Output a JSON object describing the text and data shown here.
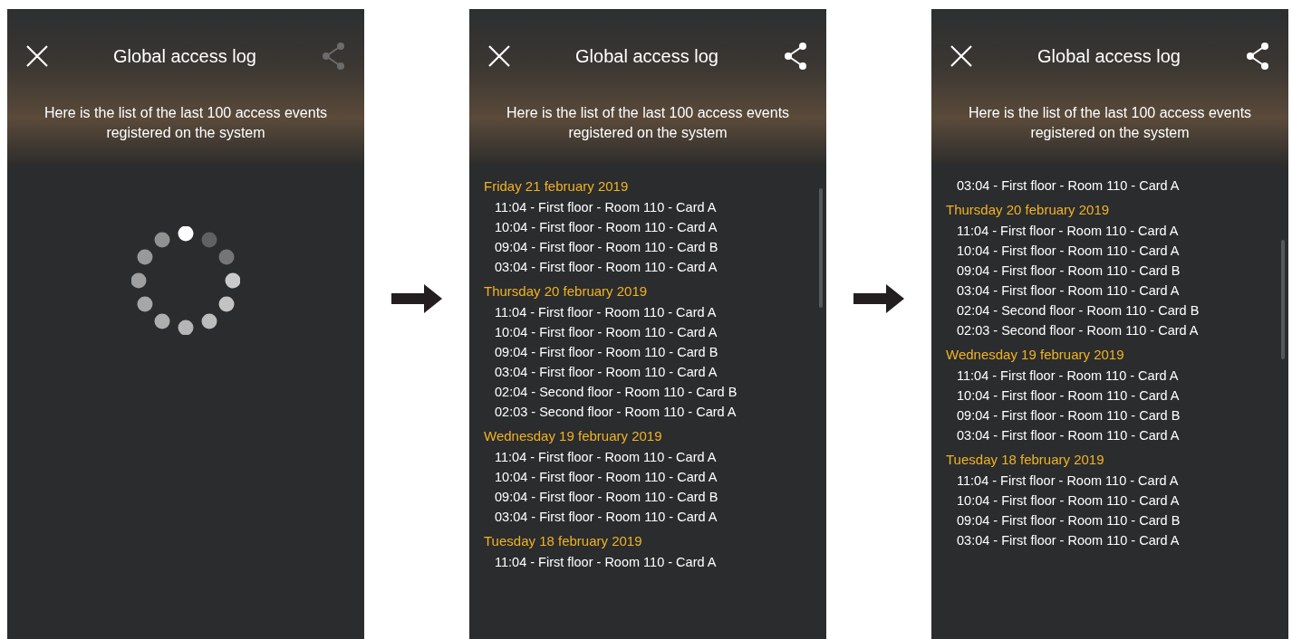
{
  "screens": [
    {
      "kind": "loading",
      "title": "Global access log",
      "share_enabled": false,
      "intro": "Here is the list of the last 100 access events registered on the system"
    },
    {
      "kind": "list",
      "title": "Global access log",
      "share_enabled": true,
      "intro": "Here is the list of the last 100 access events registered on the system",
      "groups": [
        {
          "date": "Friday 21 february 2019",
          "entries": [
            "11:04 - First floor - Room 110 - Card A",
            "10:04 - First floor - Room 110 - Card A",
            "09:04 - First floor - Room 110 - Card B",
            "03:04 - First floor - Room 110 - Card A"
          ]
        },
        {
          "date": "Thursday 20 february 2019",
          "entries": [
            "11:04 - First floor - Room 110 - Card A",
            "10:04 - First floor - Room 110 - Card A",
            "09:04 - First floor - Room 110 - Card B",
            "03:04 - First floor - Room 110 - Card A",
            "02:04 - Second floor - Room 110 - Card B",
            "02:03 - Second floor - Room 110 - Card A"
          ]
        },
        {
          "date": "Wednesday 19 february 2019",
          "entries": [
            "11:04 - First floor - Room 110 - Card A",
            "10:04 - First floor - Room 110 - Card A",
            "09:04 - First floor - Room 110 - Card B",
            "03:04 - First floor - Room 110 - Card A"
          ]
        },
        {
          "date": "Tuesday 18 february 2019",
          "entries": [
            "11:04 - First floor - Room 110 - Card A"
          ]
        }
      ]
    },
    {
      "kind": "list",
      "title": "Global access log",
      "share_enabled": true,
      "intro": "Here is the list of the last 100 access events registered on the system",
      "groups": [
        {
          "entries": [
            "03:04 - First floor - Room 110 - Card A"
          ]
        },
        {
          "date": "Thursday 20 february 2019",
          "entries": [
            "11:04 - First floor - Room 110 - Card A",
            "10:04 - First floor - Room 110 - Card A",
            "09:04 - First floor - Room 110 - Card B",
            "03:04 - First floor - Room 110 - Card A",
            "02:04 - Second floor - Room 110 - Card B",
            "02:03 - Second floor - Room 110 - Card A"
          ]
        },
        {
          "date": "Wednesday 19 february 2019",
          "entries": [
            "11:04 - First floor - Room 110 - Card A",
            "10:04 - First floor - Room 110 - Card A",
            "09:04 - First floor - Room 110 - Card B",
            "03:04 - First floor - Room 110 - Card A"
          ]
        },
        {
          "date": "Tuesday 18 february 2019",
          "entries": [
            "11:04 - First floor - Room 110 - Card A",
            "10:04 - First floor - Room 110 - Card A",
            "09:04 - First floor - Room 110 - Card B",
            "03:04 - First floor - Room 110 - Card A"
          ]
        }
      ]
    }
  ]
}
